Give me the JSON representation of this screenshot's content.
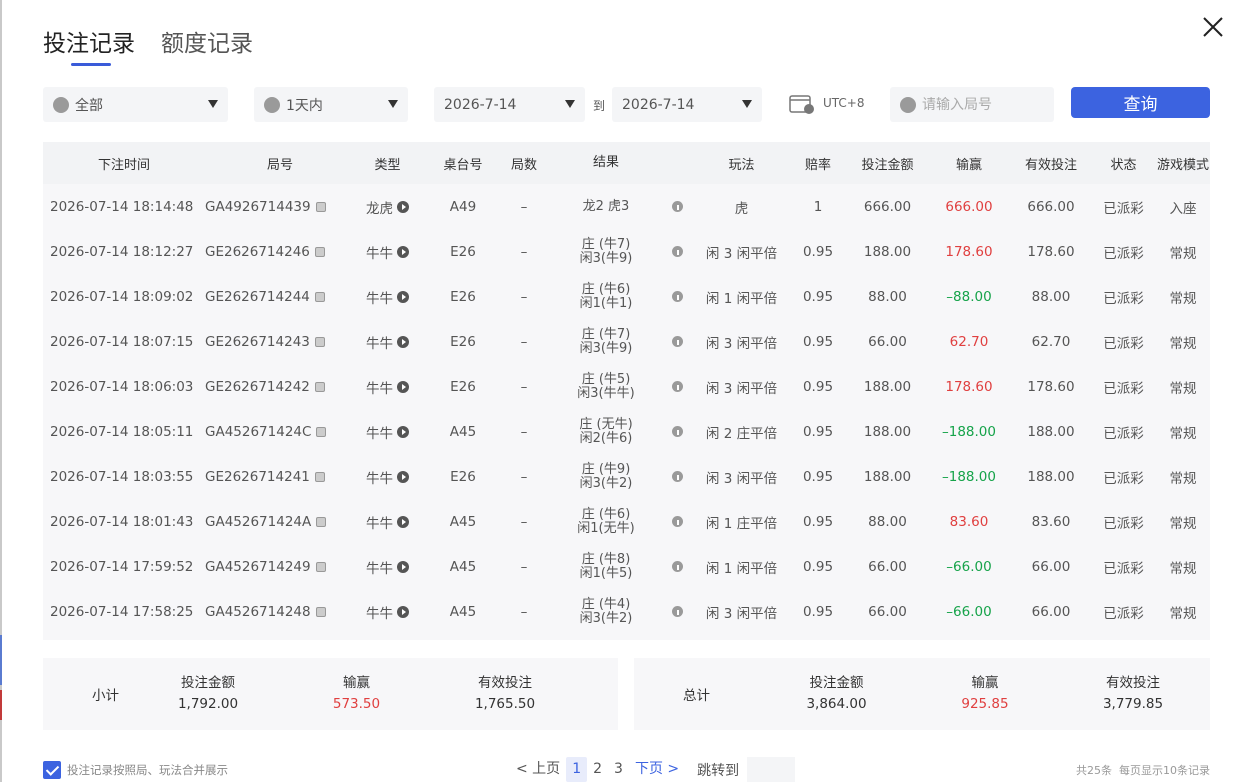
{
  "tabs": [
    {
      "label": "投注记录",
      "active": true
    },
    {
      "label": "额度记录",
      "active": false
    }
  ],
  "filters": {
    "game_type": "全部",
    "time_range": "1天内",
    "date_from": "2026-7-14",
    "to_label": "到",
    "date_to": "2026-7-14",
    "timezone": "UTC+8",
    "round_placeholder": "请输入局号",
    "query_label": "查询"
  },
  "table": {
    "headers": [
      "下注时间",
      "局号",
      "类型",
      "桌台号",
      "局数",
      "结果",
      "玩法",
      "赔率",
      "投注金额",
      "输赢",
      "有效投注",
      "状态",
      "游戏模式"
    ],
    "rows": [
      {
        "time": "2026-07-14 18:14:48",
        "round": "GA4926714439",
        "type": "龙虎",
        "table": "A49",
        "hand": "–",
        "result1": "龙2 虎3",
        "result2": "",
        "play": "虎",
        "odds": "1",
        "bet": "666.00",
        "winloss": "666.00",
        "sign": "pos",
        "valid": "666.00",
        "status": "已派彩",
        "mode": "入座"
      },
      {
        "time": "2026-07-14 18:12:27",
        "round": "GE2626714246",
        "type": "牛牛",
        "table": "E26",
        "hand": "–",
        "result1": "庄 (牛7)",
        "result2": "闲3(牛9)",
        "play": "闲 3 闲平倍",
        "odds": "0.95",
        "bet": "188.00",
        "winloss": "178.60",
        "sign": "pos",
        "valid": "178.60",
        "status": "已派彩",
        "mode": "常规"
      },
      {
        "time": "2026-07-14 18:09:02",
        "round": "GE2626714244",
        "type": "牛牛",
        "table": "E26",
        "hand": "–",
        "result1": "庄 (牛6)",
        "result2": "闲1(牛1)",
        "play": "闲 1 闲平倍",
        "odds": "0.95",
        "bet": "88.00",
        "winloss": "–88.00",
        "sign": "neg",
        "valid": "88.00",
        "status": "已派彩",
        "mode": "常规"
      },
      {
        "time": "2026-07-14 18:07:15",
        "round": "GE2626714243",
        "type": "牛牛",
        "table": "E26",
        "hand": "–",
        "result1": "庄 (牛7)",
        "result2": "闲3(牛9)",
        "play": "闲 3 闲平倍",
        "odds": "0.95",
        "bet": "66.00",
        "winloss": "62.70",
        "sign": "pos",
        "valid": "62.70",
        "status": "已派彩",
        "mode": "常规"
      },
      {
        "time": "2026-07-14 18:06:03",
        "round": "GE2626714242",
        "type": "牛牛",
        "table": "E26",
        "hand": "–",
        "result1": "庄 (牛5)",
        "result2": "闲3(牛牛)",
        "play": "闲 3 闲平倍",
        "odds": "0.95",
        "bet": "188.00",
        "winloss": "178.60",
        "sign": "pos",
        "valid": "178.60",
        "status": "已派彩",
        "mode": "常规"
      },
      {
        "time": "2026-07-14 18:05:11",
        "round": "GA452671424C",
        "type": "牛牛",
        "table": "A45",
        "hand": "–",
        "result1": "庄 (无牛)",
        "result2": "闲2(牛6)",
        "play": "闲 2 庄平倍",
        "odds": "0.95",
        "bet": "188.00",
        "winloss": "–188.00",
        "sign": "neg",
        "valid": "188.00",
        "status": "已派彩",
        "mode": "常规"
      },
      {
        "time": "2026-07-14 18:03:55",
        "round": "GE2626714241",
        "type": "牛牛",
        "table": "E26",
        "hand": "–",
        "result1": "庄 (牛9)",
        "result2": "闲3(牛2)",
        "play": "闲 3 闲平倍",
        "odds": "0.95",
        "bet": "188.00",
        "winloss": "–188.00",
        "sign": "neg",
        "valid": "188.00",
        "status": "已派彩",
        "mode": "常规"
      },
      {
        "time": "2026-07-14 18:01:43",
        "round": "GA452671424A",
        "type": "牛牛",
        "table": "A45",
        "hand": "–",
        "result1": "庄 (牛6)",
        "result2": "闲1(无牛)",
        "play": "闲 1 庄平倍",
        "odds": "0.95",
        "bet": "88.00",
        "winloss": "83.60",
        "sign": "pos",
        "valid": "83.60",
        "status": "已派彩",
        "mode": "常规"
      },
      {
        "time": "2026-07-14 17:59:52",
        "round": "GA4526714249",
        "type": "牛牛",
        "table": "A45",
        "hand": "–",
        "result1": "庄 (牛8)",
        "result2": "闲1(牛5)",
        "play": "闲 1 闲平倍",
        "odds": "0.95",
        "bet": "66.00",
        "winloss": "–66.00",
        "sign": "neg",
        "valid": "66.00",
        "status": "已派彩",
        "mode": "常规"
      },
      {
        "time": "2026-07-14 17:58:25",
        "round": "GA4526714248",
        "type": "牛牛",
        "table": "A45",
        "hand": "–",
        "result1": "庄 (牛4)",
        "result2": "闲3(牛2)",
        "play": "闲 3 闲平倍",
        "odds": "0.95",
        "bet": "66.00",
        "winloss": "–66.00",
        "sign": "neg",
        "valid": "66.00",
        "status": "已派彩",
        "mode": "常规"
      }
    ]
  },
  "subtotal": {
    "label": "小计",
    "bet_label": "投注金额",
    "bet": "1,792.00",
    "win_label": "输赢",
    "win": "573.50",
    "valid_label": "有效投注",
    "valid": "1,765.50"
  },
  "total": {
    "label": "总计",
    "bet_label": "投注金额",
    "bet": "3,864.00",
    "win_label": "输赢",
    "win": "925.85",
    "valid_label": "有效投注",
    "valid": "3,779.85"
  },
  "footer": {
    "merge_label": "投注记录按照局、玩法合并展示",
    "prev": "< 上页",
    "pages": [
      "1",
      "2",
      "3"
    ],
    "next": "下页 >",
    "jump_label": "跳转到",
    "total_info": "共25条",
    "per_page_info": "每页显示10条记录"
  },
  "colors": {
    "accent": "#3c63e0",
    "positive": "#e04040",
    "negative": "#16a34a"
  }
}
